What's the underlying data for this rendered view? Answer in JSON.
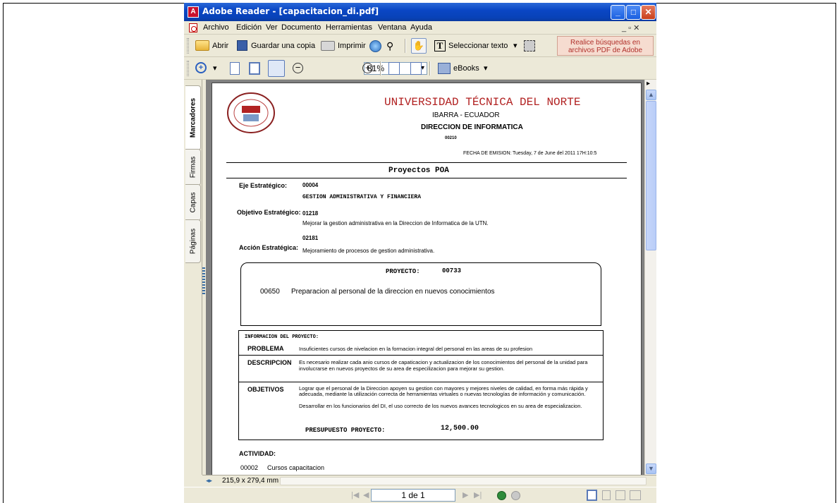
{
  "window": {
    "title": "Adobe Reader - [capacitacion_di.pdf]",
    "min_label": "_",
    "max_label": "□",
    "close_label": "✕"
  },
  "menu": {
    "items": [
      "Archivo",
      "Edición",
      "Ver",
      "Documento",
      "Herramientas",
      "Ventana",
      "Ayuda"
    ],
    "doc_controls": "_ ▫ ✕"
  },
  "toolbar": {
    "open": "Abrir",
    "save_copy": "Guardar una copia",
    "print": "Imprimir",
    "select_text": "Seleccionar texto",
    "search_banner": "Realice búsquedas en archivos PDF de Adobe",
    "zoom_value": "81%",
    "ebooks": "eBooks"
  },
  "side_tabs": [
    "Marcadores",
    "Firmas",
    "Capas",
    "Páginas"
  ],
  "status": {
    "page_size": "215,9 x 279,4 mm",
    "page_indicator": "1 de 1"
  },
  "document": {
    "university": "UNIVERSIDAD TÉCNICA DEL NORTE",
    "city": "IBARRA - ECUADOR",
    "department": "DIRECCION DE INFORMATICA",
    "dept_code": "00210",
    "emission_label": "FECHA DE EMISION:",
    "emission_date": "Tuesday, 7 de June del 2011  17H:10:5",
    "section_title": "Proyectos POA",
    "eje_label": "Eje Estratégico:",
    "eje_code": "00004",
    "eje_name": "GESTION ADMINISTRATIVA Y FINANCIERA",
    "objetivo_label": "Objetivo Estratégico:",
    "objetivo_code": "01218",
    "objetivo_text": "Mejorar la gestion administrativa en la Direccion de Informatica de la UTN.",
    "accion_label": "Acción Estratégica:",
    "accion_code": "02181",
    "accion_text": "Mejoramiento de procesos de gestion administrativa.",
    "proyecto_label": "PROYECTO:",
    "proyecto_code": "00733",
    "proyecto_item_code": "00650",
    "proyecto_item_text": "Preparacion al personal de la direccion en nuevos conocimientos",
    "info_header": "INFORMACION DEL PROYECTO:",
    "problema_label": "PROBLEMA",
    "problema_text": "Insuficientes cursos de nivelacion en la formacion integral del personal en las areas de su profesion",
    "descripcion_label": "DESCRIPCION",
    "descripcion_text": "Es necesario realizar cada anio cursos de capaticacion y actualizacion de los conocimientos del personal de la unidad para involucrarse en nuevos proyectos de su area de especilizacion para mejorar su gestion.",
    "objetivos_label": "OBJETIVOS",
    "objetivos_text1": "Lograr que el personal de la Direccion apoyen su gestion con mayores y mejores niveles de calidad, en forma más rápida y adecuada, mediante la utilización correcta de herramientas virtuales o nuevas tecnologías de información y comunicación.",
    "objetivos_text2": "Desarrollar en los funcionarios del DI, el uso correcto de los nuevos avances tecnologicos en su area de especializacion.",
    "presupuesto_label": "PRESUPUESTO PROYECTO:",
    "presupuesto_value": "12,500.00",
    "actividad_label": "ACTIVIDAD:",
    "actividad_code": "00002",
    "actividad_text": "Cursos capacitacion",
    "seal_text": "UTN"
  },
  "colors": {
    "title_red": "#b22222",
    "titlebar_blue": "#0a46c4"
  }
}
